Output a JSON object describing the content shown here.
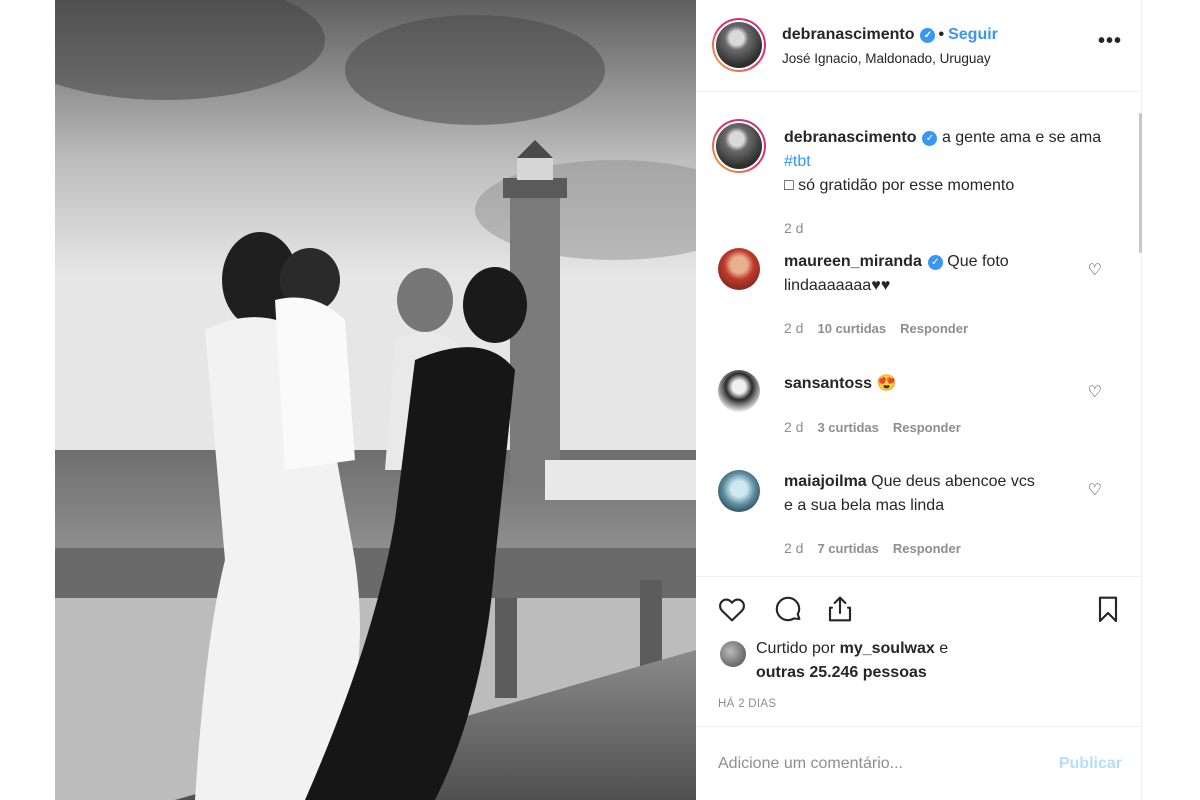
{
  "post": {
    "username": "debranascimento",
    "follow_label": "Seguir",
    "separator": "•",
    "location": "José Ignacio, Maldonado, Uruguay",
    "more_label": "•••",
    "verified_icon": "verified-badge-icon"
  },
  "caption": {
    "username": "debranascimento",
    "text_line1": "a gente ama e se ama",
    "hashtag": "#tbt",
    "text_line2": "□ só gratidão por esse momento",
    "time": "2 d"
  },
  "comments": [
    {
      "username": "maureen_miranda",
      "text": "Que foto lindaaaaaaa♥♥",
      "time": "2 d",
      "likes": "10 curtidas",
      "reply": "Responder"
    },
    {
      "username": "sansantoss",
      "text": "😍",
      "time": "2 d",
      "likes": "3 curtidas",
      "reply": "Responder"
    },
    {
      "username": "maiajoilma",
      "text": "Que deus abencoe vcs e a sua bela mas linda",
      "time": "2 d",
      "likes": "7 curtidas",
      "reply": "Responder"
    }
  ],
  "likes": {
    "prefix": "Curtido por",
    "user": "my_soulwax",
    "suffix": "e",
    "others": "outras 25.246 pessoas"
  },
  "time_ago": "HÁ 2 DIAS",
  "add_comment": {
    "placeholder": "Adicione um comentário...",
    "publish_label": "Publicar"
  },
  "colors": {
    "link_blue": "#3897f0",
    "publish_disabled": "#b2dffc",
    "muted": "#8e8e8e",
    "text": "#262626"
  }
}
